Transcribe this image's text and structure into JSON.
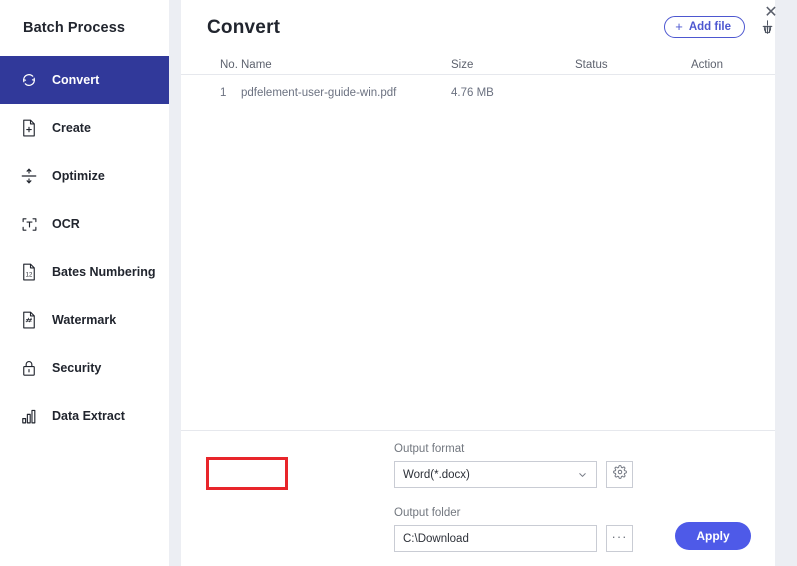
{
  "sidebar": {
    "brand_title": "Batch Process",
    "items": [
      {
        "label": "Convert",
        "icon": "refresh-icon",
        "active": true
      },
      {
        "label": "Create",
        "icon": "file-plus-icon",
        "active": false
      },
      {
        "label": "Optimize",
        "icon": "compress-icon",
        "active": false
      },
      {
        "label": "OCR",
        "icon": "ocr-text-icon",
        "active": false
      },
      {
        "label": "Bates Numbering",
        "icon": "bates-number-icon",
        "active": false
      },
      {
        "label": "Watermark",
        "icon": "watermark-icon",
        "active": false
      },
      {
        "label": "Security",
        "icon": "lock-icon",
        "active": false
      },
      {
        "label": "Data Extract",
        "icon": "bar-chart-icon",
        "active": false
      }
    ]
  },
  "window": {
    "close_label": "✕"
  },
  "header": {
    "title": "Convert",
    "add_file_label": "Add file",
    "add_file_plus": "+",
    "clear_icon_name": "broom-icon"
  },
  "table": {
    "columns": [
      "No.",
      "Name",
      "Size",
      "Status",
      "Action"
    ],
    "rows": [
      {
        "no": "1",
        "name": "pdfelement-user-guide-win.pdf",
        "size": "4.76 MB",
        "status": "",
        "action": ""
      }
    ]
  },
  "output": {
    "format_label": "Output format",
    "format_value": "Word(*.docx)",
    "format_settings_icon": "gear-icon",
    "folder_label": "Output folder",
    "folder_value": "C:\\Download",
    "folder_browse_label": "···"
  },
  "actions": {
    "apply_label": "Apply"
  },
  "colors": {
    "sidebar_active": "#31399a",
    "accent_blue": "#4e5ae8",
    "add_file_border": "#4d57d0",
    "page_bg": "#eceef3",
    "panel_bg": "#ffffff",
    "highlight_red": "#e8252a",
    "text_dark": "#21252e",
    "text_muted": "#6b7180"
  }
}
